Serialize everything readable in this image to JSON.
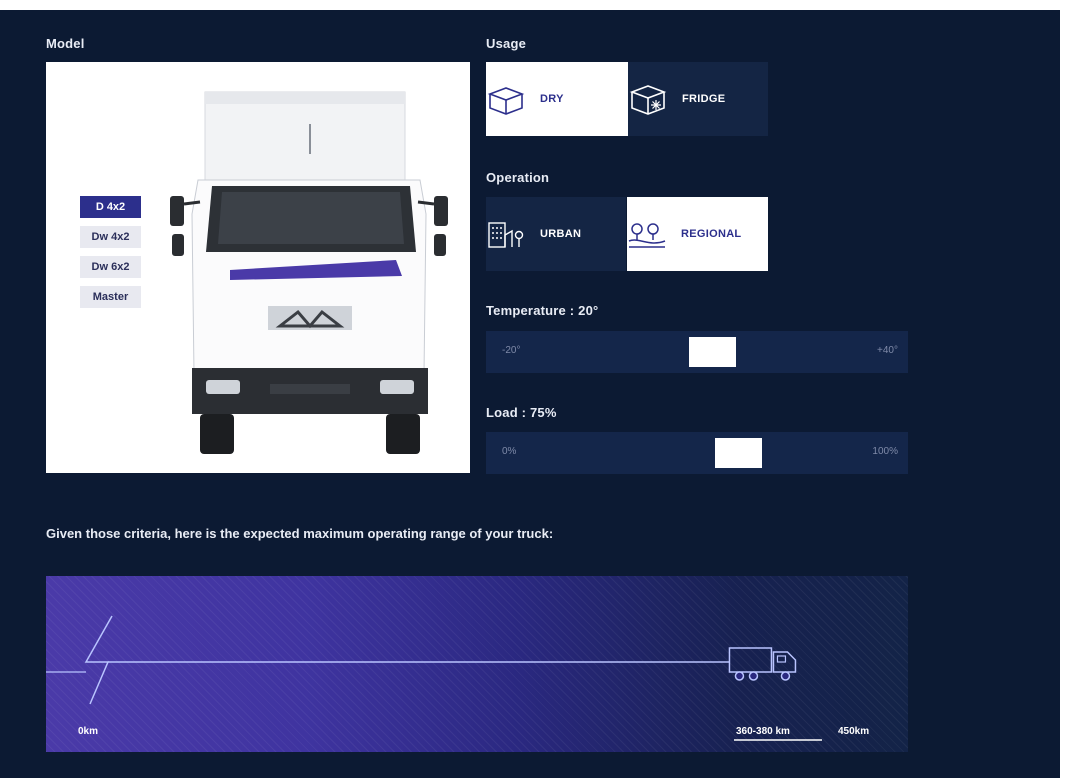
{
  "model": {
    "label": "Model",
    "items": [
      {
        "label": "D 4x2",
        "active": true
      },
      {
        "label": "Dw 4x2",
        "active": false
      },
      {
        "label": "Dw 6x2",
        "active": false
      },
      {
        "label": "Master",
        "active": false
      }
    ]
  },
  "usage": {
    "label": "Usage",
    "options": [
      {
        "label": "DRY",
        "selected": true,
        "icon": "box-icon"
      },
      {
        "label": "FRIDGE",
        "selected": false,
        "icon": "fridge-box-icon"
      }
    ]
  },
  "operation": {
    "label": "Operation",
    "options": [
      {
        "label": "URBAN",
        "selected": false,
        "icon": "city-icon"
      },
      {
        "label": "REGIONAL",
        "selected": true,
        "icon": "road-trees-icon"
      }
    ]
  },
  "temperature": {
    "label": "Temperature : 20°",
    "min_label": "-20°",
    "max_label": "+40°",
    "value_fraction": 0.67
  },
  "load": {
    "label": "Load : 75%",
    "min_label": "0%",
    "max_label": "100%",
    "value_fraction": 0.75
  },
  "criteria_text": "Given those criteria, here is the expected maximum operating range of your truck:",
  "range": {
    "start_label": "0km",
    "result_label": "360-380 km",
    "max_label": "450km",
    "result_fraction": 0.83
  },
  "colors": {
    "background": "#0c1a33",
    "accent": "#2c2f8c",
    "tile_off": "#142544",
    "line": "#b9c4ff"
  }
}
